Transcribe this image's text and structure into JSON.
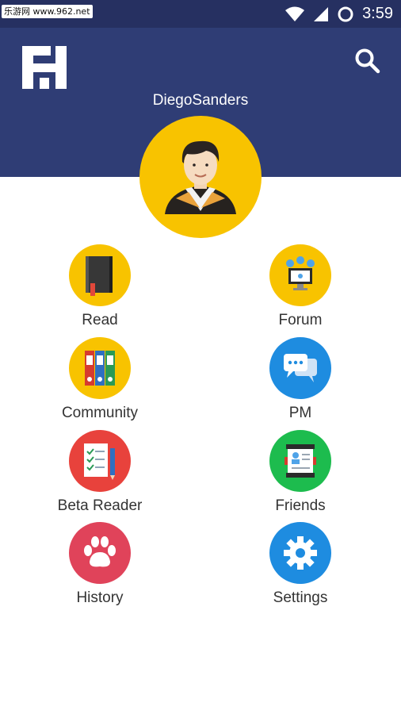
{
  "status_bar": {
    "watermark": "乐游网 www.962.net",
    "time": "3:59",
    "icons": [
      "wifi-icon",
      "signal-icon",
      "sync-icon"
    ]
  },
  "header": {
    "logo": "app-logo",
    "username": "DiegoSanders",
    "search_icon": "search-icon",
    "background": "#2f3d75"
  },
  "menu": [
    {
      "label": "Read",
      "icon": "notebook-icon",
      "color": "#f8c300"
    },
    {
      "label": "Forum",
      "icon": "forum-computer-icon",
      "color": "#f8c300"
    },
    {
      "label": "Community",
      "icon": "binders-icon",
      "color": "#f8c300"
    },
    {
      "label": "PM",
      "icon": "chat-bubbles-icon",
      "color": "#1e8ce0"
    },
    {
      "label": "Beta Reader",
      "icon": "checklist-icon",
      "color": "#e8423c"
    },
    {
      "label": "Friends",
      "icon": "contacts-icon",
      "color": "#1dbc4e"
    },
    {
      "label": "History",
      "icon": "paw-icon",
      "color": "#e0435a"
    },
    {
      "label": "Settings",
      "icon": "gear-icon",
      "color": "#1e8ce0"
    }
  ]
}
